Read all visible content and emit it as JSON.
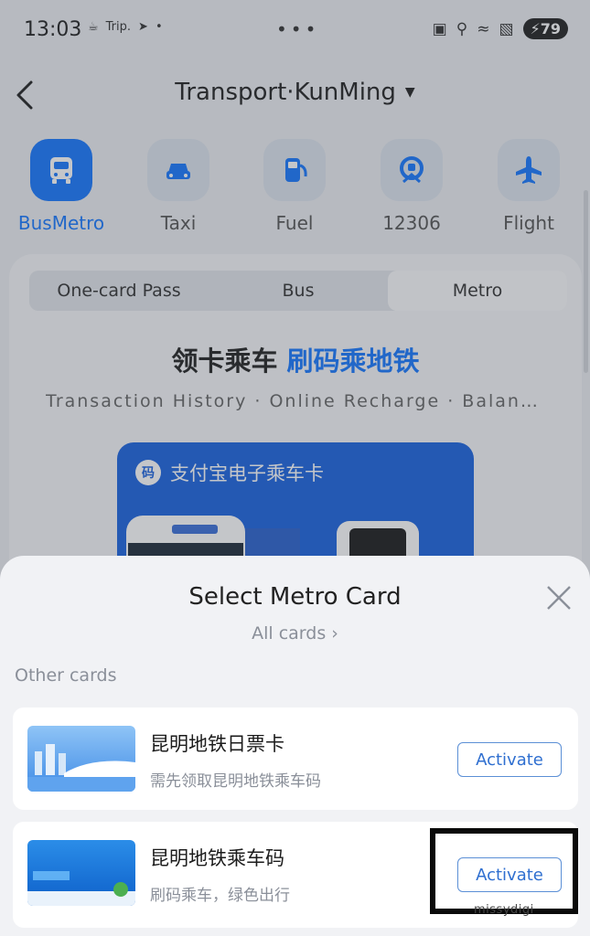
{
  "status_bar": {
    "time": "13:03",
    "left_icons": [
      "meal-icon",
      "trip-icon",
      "send-icon",
      "dot-icon"
    ],
    "trip_text": "Trip.",
    "dots": "•••",
    "right_icons": [
      "cast-icon",
      "location-icon",
      "wifi-icon",
      "signal-icon"
    ],
    "battery": "79"
  },
  "nav": {
    "title": "Transport·KunMing"
  },
  "categories": [
    {
      "label": "BusMetro",
      "icon": "bus-icon",
      "active": true
    },
    {
      "label": "Taxi",
      "icon": "taxi-icon",
      "active": false
    },
    {
      "label": "Fuel",
      "icon": "fuel-icon",
      "active": false
    },
    {
      "label": "12306",
      "icon": "train-icon",
      "active": false
    },
    {
      "label": "Flight",
      "icon": "plane-icon",
      "active": false
    }
  ],
  "tabs": [
    {
      "label": "One-card Pass",
      "selected": false
    },
    {
      "label": "Bus",
      "selected": false
    },
    {
      "label": "Metro",
      "selected": true
    }
  ],
  "promo": {
    "title_plain": "领卡乘车 ",
    "title_highlight": "刷码乘地铁",
    "subtitle": "Transaction History · Online Recharge · Balan…",
    "card_title": "支付宝电子乘车卡"
  },
  "sheet": {
    "title": "Select Metro Card",
    "all_cards": "All cards",
    "section_label": "Other cards",
    "cards": [
      {
        "name": "昆明地铁日票卡",
        "desc": "需先领取昆明地铁乘车码",
        "button": "Activate"
      },
      {
        "name": "昆明地铁乘车码",
        "desc": "刷码乘车，绿色出行",
        "button": "Activate"
      }
    ]
  },
  "watermark": "missydigi",
  "colors": {
    "accent": "#1677ff",
    "button_border": "#5b8fd6",
    "sheet_bg": "#f1f2f5"
  }
}
